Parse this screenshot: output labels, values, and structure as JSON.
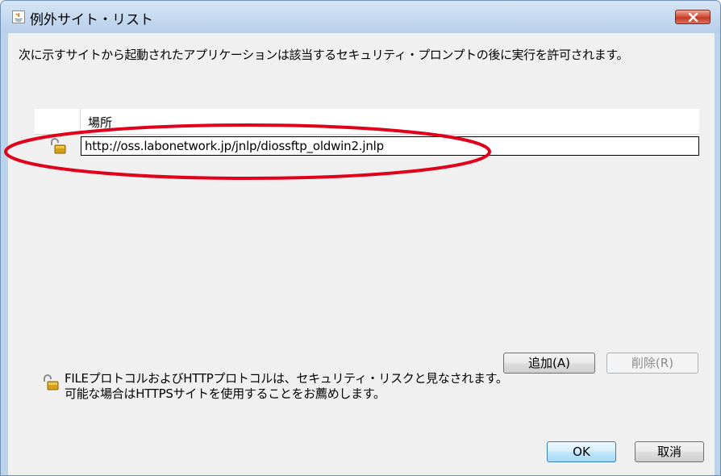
{
  "window": {
    "title": "例外サイト・リスト",
    "close_icon": "close-x-icon",
    "app_icon": "java-icon"
  },
  "description": "次に示すサイトから起動されたアプリケーションは該当するセキュリティ・プロンプトの後に実行を許可されます。",
  "table": {
    "column_header": "場所",
    "rows": [
      {
        "icon": "unlocked-padlock-icon",
        "url": "http://oss.labonetwork.jp/jnlp/diossftp_oldwin2.jnlp"
      }
    ]
  },
  "buttons": {
    "add": "追加(A)",
    "remove": "削除(R)",
    "ok": "OK",
    "cancel": "取消"
  },
  "warning": {
    "icon": "unlocked-padlock-icon",
    "line1": "FILEプロトコルおよびHTTPプロトコルは、セキュリティ・リスクと見なされます。",
    "line2": "可能な場合はHTTPSサイトを使用することをお薦めします。"
  },
  "colors": {
    "annotation": "#e0001a",
    "title_bar": "#c3d8ef",
    "close_button": "#c9452e"
  }
}
